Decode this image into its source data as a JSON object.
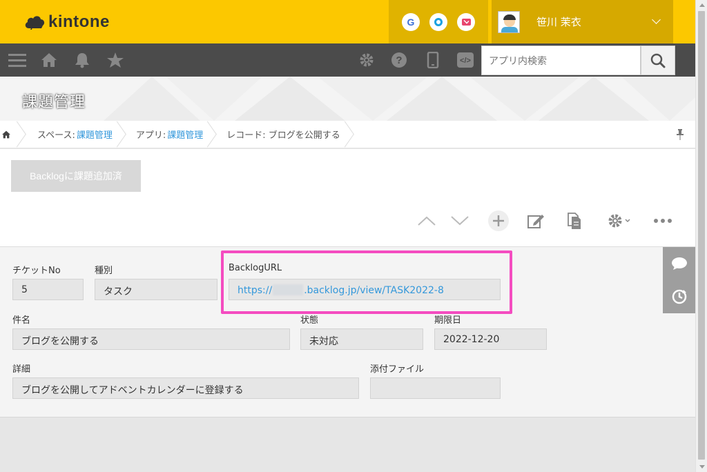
{
  "brand": {
    "name": "kintone",
    "accent": "#fcc800"
  },
  "header": {
    "services": [
      "G",
      "garoon-icon",
      "mail-icon"
    ],
    "user_name": "笹川 茉衣"
  },
  "nav": {
    "search_placeholder": "アプリ内検索"
  },
  "app": {
    "title": "課題管理"
  },
  "breadcrumb": {
    "space_label": "スペース:",
    "space_name": "課題管理",
    "app_label": "アプリ:",
    "app_name": "課題管理",
    "record_label": "レコード: ブログを公開する"
  },
  "actions": {
    "backlog_button": "Backlogに課題追加済"
  },
  "record": {
    "ticket_no": {
      "label": "チケットNo",
      "value": "5"
    },
    "type": {
      "label": "種別",
      "value": "タスク"
    },
    "backlog_url": {
      "label": "BacklogURL",
      "prefix": "https://",
      "suffix": ".backlog.jp/view/TASK2022-8"
    },
    "subject": {
      "label": "件名",
      "value": "ブログを公開する"
    },
    "status": {
      "label": "状態",
      "value": "未対応"
    },
    "due_date": {
      "label": "期限日",
      "value": "2022-12-20"
    },
    "detail": {
      "label": "詳細",
      "value": "ブログを公開してアドベントカレンダーに登録する"
    },
    "attachment": {
      "label": "添付ファイル",
      "value": ""
    }
  },
  "colors": {
    "highlight": "#f44cc0",
    "link": "#3498db",
    "nav_bg": "#4b4b4b"
  }
}
